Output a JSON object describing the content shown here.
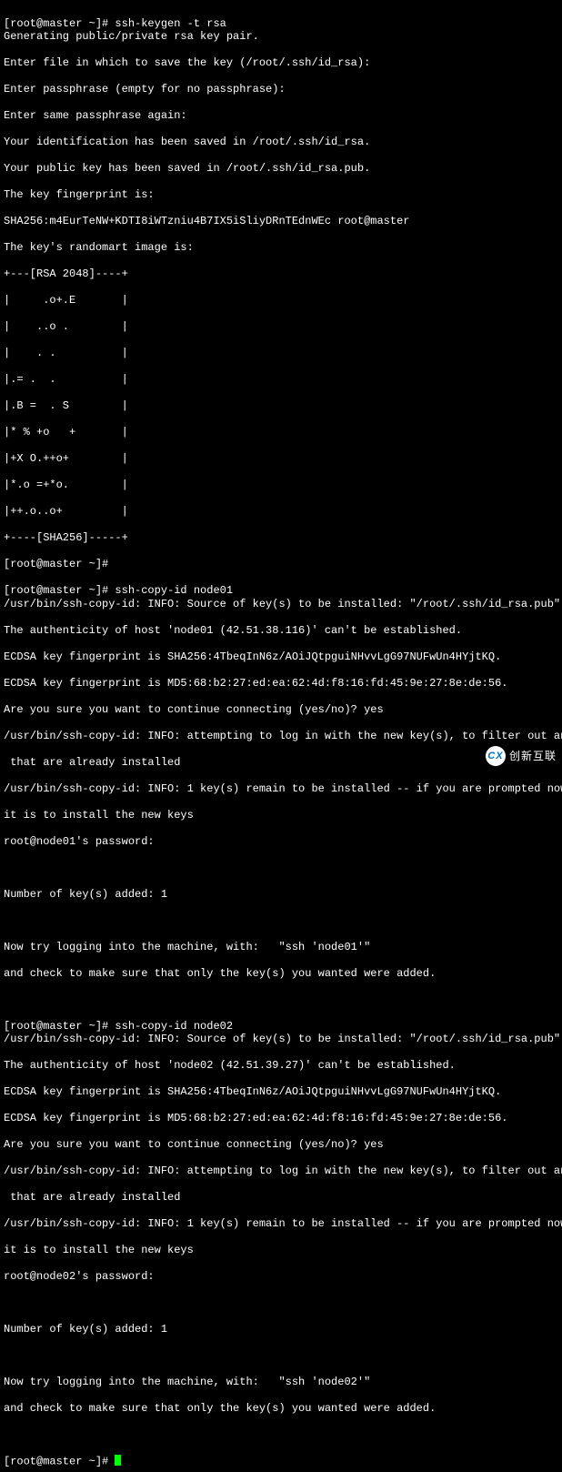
{
  "prompt1": "[root@master ~]# ",
  "cmd1": "ssh-keygen -t rsa",
  "keygen": {
    "l1": "Generating public/private rsa key pair.",
    "l2": "Enter file in which to save the key (/root/.ssh/id_rsa):",
    "l3": "Enter passphrase (empty for no passphrase):",
    "l4": "Enter same passphrase again:",
    "l5": "Your identification has been saved in /root/.ssh/id_rsa.",
    "l6": "Your public key has been saved in /root/.ssh/id_rsa.pub.",
    "l7": "The key fingerprint is:",
    "l8": "SHA256:m4EurTeNW+KDTI8iWTzniu4B7IX5iSliyDRnTEdnWEc root@master",
    "l9": "The key's randomart image is:"
  },
  "art": {
    "a0": "+---[RSA 2048]----+",
    "a1": "|     .o+.E       |",
    "a2": "|    ..o .        |",
    "a3": "|    . .          |",
    "a4": "|.= .  .          |",
    "a5": "|.B =  . S        |",
    "a6": "|* % +o   +       |",
    "a7": "|+X O.++o+        |",
    "a8": "|*.o =+*o.        |",
    "a9": "|++.o..o+         |",
    "a10": "+----[SHA256]-----+"
  },
  "prompt2": "[root@master ~]#",
  "cmd2": "ssh-copy-id node01",
  "copy1": {
    "l1": "/usr/bin/ssh-copy-id: INFO: Source of key(s) to be installed: \"/root/.ssh/id_rsa.pub\"",
    "l2": "The authenticity of host 'node01 (42.51.38.116)' can't be established.",
    "l3": "ECDSA key fingerprint is SHA256:4TbeqInN6z/AOiJQtpguiNHvvLgG97NUFwUn4HYjtKQ.",
    "l4": "ECDSA key fingerprint is MD5:68:b2:27:ed:ea:62:4d:f8:16:fd:45:9e:27:8e:de:56.",
    "l5": "Are you sure you want to continue connecting (yes/no)? yes",
    "l6a": "/usr/bin/ssh-copy-id: INFO: attempting to log in with the new key(s), to filter out any",
    "l6b": " that are already installed",
    "l7a": "/usr/bin/ssh-copy-id: INFO: 1 key(s) remain to be installed -- if you are prompted now ",
    "l7b": "it is to install the new keys",
    "l8": "root@node01's password:",
    "l9": "Number of key(s) added: 1",
    "l10": "Now try logging into the machine, with:   \"ssh 'node01'\"",
    "l11": "and check to make sure that only the key(s) you wanted were added."
  },
  "cmd3": "ssh-copy-id node02",
  "copy2": {
    "l1": "/usr/bin/ssh-copy-id: INFO: Source of key(s) to be installed: \"/root/.ssh/id_rsa.pub\"",
    "l2": "The authenticity of host 'node02 (42.51.39.27)' can't be established.",
    "l3": "ECDSA key fingerprint is SHA256:4TbeqInN6z/AOiJQtpguiNHvvLgG97NUFwUn4HYjtKQ.",
    "l4": "ECDSA key fingerprint is MD5:68:b2:27:ed:ea:62:4d:f8:16:fd:45:9e:27:8e:de:56.",
    "l5": "Are you sure you want to continue connecting (yes/no)? yes",
    "l6a": "/usr/bin/ssh-copy-id: INFO: attempting to log in with the new key(s), to filter out any",
    "l6b": " that are already installed",
    "l7a": "/usr/bin/ssh-copy-id: INFO: 1 key(s) remain to be installed -- if you are prompted now ",
    "l7b": "it is to install the new keys",
    "l8": "root@node02's password:",
    "l9": "Number of key(s) added: 1",
    "l10": "Now try logging into the machine, with:   \"ssh 'node02'\"",
    "l11": "and check to make sure that only the key(s) you wanted were added."
  },
  "watermark": "创新互联"
}
